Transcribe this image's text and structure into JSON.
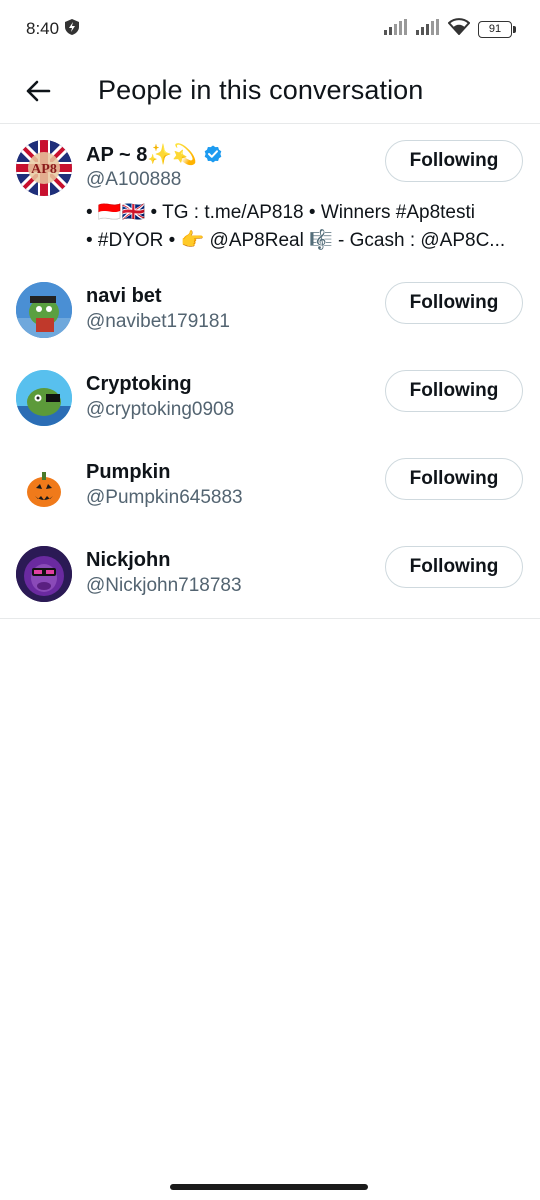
{
  "status_bar": {
    "time": "8:40",
    "battery": "91"
  },
  "header": {
    "title": "People in this conversation"
  },
  "people": [
    {
      "name": "AP ~ 8✨💫",
      "handle": "@A100888",
      "verified": true,
      "bio_line1": "• 🇮🇩🇬🇧 • TG : t.me/AP818 • Winners #Ap8testi",
      "bio_line2": "• #DYOR • 👉 @AP8Real 🎼 - Gcash : @AP8C...",
      "button": "Following"
    },
    {
      "name": "navi bet",
      "handle": "@navibet179181",
      "button": "Following"
    },
    {
      "name": "Cryptoking",
      "handle": "@cryptoking0908",
      "button": "Following"
    },
    {
      "name": "Pumpkin",
      "handle": "@Pumpkin645883",
      "button": "Following"
    },
    {
      "name": "Nickjohn",
      "handle": "@Nickjohn718783",
      "button": "Following"
    }
  ],
  "colors": {
    "text_primary": "#0f1419",
    "text_secondary": "#536471",
    "verified_blue": "#1d9bf0",
    "divider": "#e7e9ea"
  }
}
